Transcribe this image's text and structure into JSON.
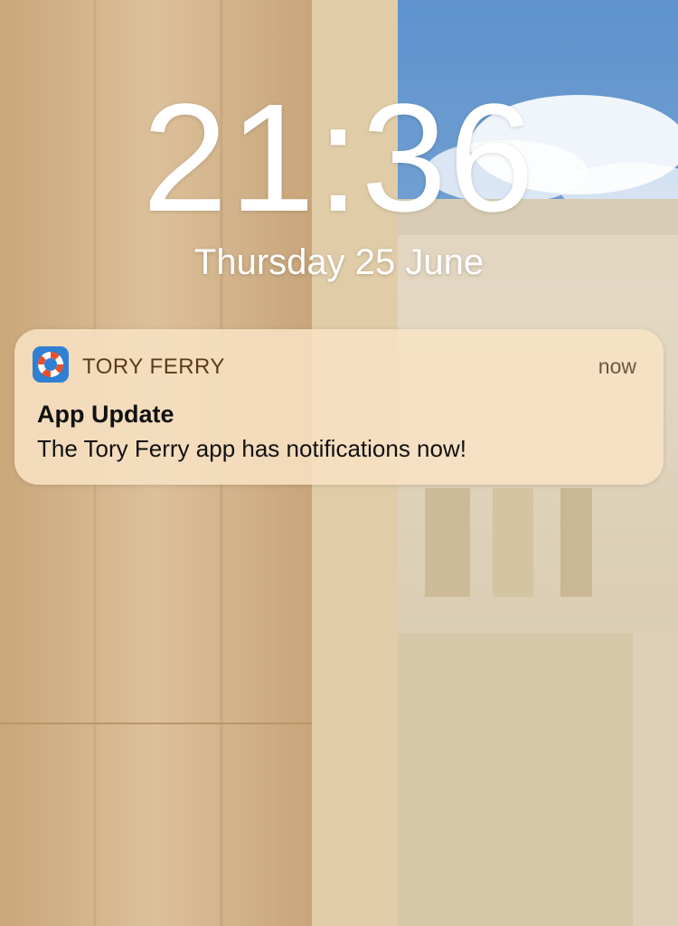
{
  "lockscreen": {
    "time": "21:36",
    "date": "Thursday 25 June",
    "wallpaper": "ancient-stone-temple-photo"
  },
  "notification": {
    "app_name": "TORY FERRY",
    "timestamp": "now",
    "title": "App Update",
    "body": "The Tory Ferry app has notifications now!",
    "icon": "lifebuoy-icon"
  },
  "colors": {
    "icon_bg": "#2f7fd3",
    "lifebuoy_red": "#e8502c",
    "notification_bg": "#f8e2c4"
  }
}
